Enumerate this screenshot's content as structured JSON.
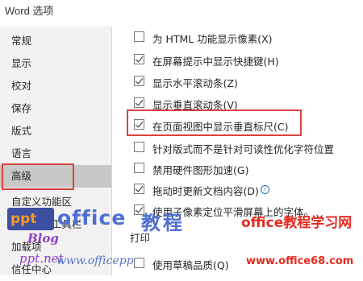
{
  "window": {
    "title": "Word 选项"
  },
  "sidebar": {
    "items": [
      {
        "label": "常规"
      },
      {
        "label": "显示"
      },
      {
        "label": "校对"
      },
      {
        "label": "保存"
      },
      {
        "label": "版式"
      },
      {
        "label": "语言"
      },
      {
        "label": "高级",
        "selected": true
      },
      {
        "label": "自定义功能区"
      },
      {
        "label": "快速访问工具栏"
      },
      {
        "label": "加载项"
      },
      {
        "label": "信任中心"
      }
    ]
  },
  "options": [
    {
      "label": "为 HTML 功能显示像素(X)",
      "checked": false
    },
    {
      "label": "在屏幕提示中显示快捷键(H)",
      "checked": true
    },
    {
      "label": "显示水平滚动条(Z)",
      "checked": true
    },
    {
      "label": "显示垂直滚动条(V)",
      "checked": true
    },
    {
      "label": "在页面视图中显示垂直标尺(C)",
      "checked": true,
      "highlighted": true
    },
    {
      "label": "针对版式而不是针对可读性优化字符位置",
      "checked": false
    },
    {
      "label": "禁用硬件图形加速(G)",
      "checked": false
    },
    {
      "label": "拖动时更新文档内容(D)",
      "checked": true,
      "info_icon": "info-icon"
    },
    {
      "label": "使用子像素定位平滑屏幕上的字体。",
      "checked": true
    }
  ],
  "print_section": {
    "title": "打印",
    "first_option": {
      "label": "使用草稿品质(Q)",
      "checked": false
    }
  },
  "watermark": {
    "logo_text": "ppt",
    "office_text": "office",
    "course_text": "教程",
    "site_cn": "office教程学习网",
    "site_url": "www.office68.com",
    "blog_text": "Blog",
    "blog_url": "www.officepp",
    "qq_text": "ppt.net"
  },
  "colors": {
    "highlight_red": "#d7443d",
    "selected_bg": "#c8c8c8",
    "sidebar_bg": "#f2f2f2"
  }
}
